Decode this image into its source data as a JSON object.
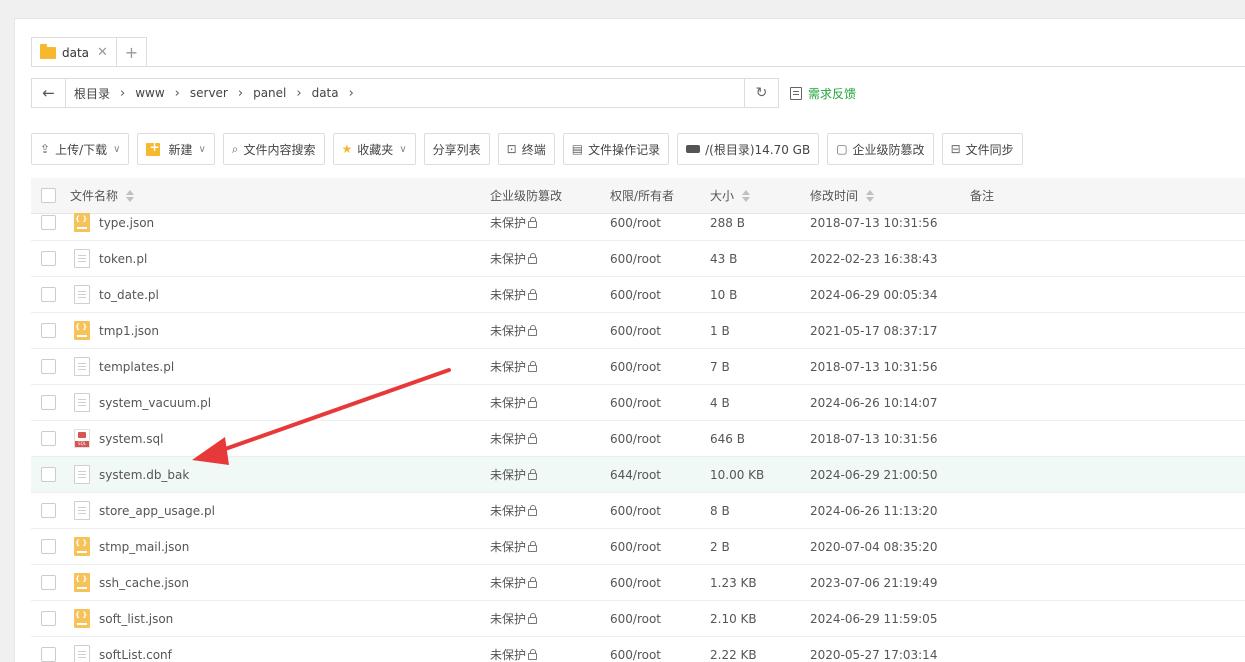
{
  "tabs": [
    {
      "label": "data"
    }
  ],
  "tab_add": "+",
  "breadcrumb": [
    "根目录",
    "www",
    "server",
    "panel",
    "data"
  ],
  "feedback": "需求反馈",
  "toolbar": {
    "upload": "上传/下载",
    "new": "新建",
    "search": "文件内容搜索",
    "favorites": "收藏夹",
    "share": "分享列表",
    "terminal": "终端",
    "oplog": "文件操作记录",
    "disk": "/(根目录)14.70 GB",
    "tamper": "企业级防篡改",
    "sync": "文件同步"
  },
  "columns": {
    "name": "文件名称",
    "tamper": "企业级防篡改",
    "perm": "权限/所有者",
    "size": "大小",
    "mtime": "修改时间",
    "note": "备注"
  },
  "rows": [
    {
      "name": "type.json",
      "icon": "json",
      "protect": "未保护",
      "perm": "600/root",
      "size": "288 B",
      "mtime": "2018-07-13 10:31:56"
    },
    {
      "name": "token.pl",
      "icon": "txt",
      "protect": "未保护",
      "perm": "600/root",
      "size": "43 B",
      "mtime": "2022-02-23 16:38:43"
    },
    {
      "name": "to_date.pl",
      "icon": "txt",
      "protect": "未保护",
      "perm": "600/root",
      "size": "10 B",
      "mtime": "2024-06-29 00:05:34"
    },
    {
      "name": "tmp1.json",
      "icon": "json",
      "protect": "未保护",
      "perm": "600/root",
      "size": "1 B",
      "mtime": "2021-05-17 08:37:17"
    },
    {
      "name": "templates.pl",
      "icon": "txt",
      "protect": "未保护",
      "perm": "600/root",
      "size": "7 B",
      "mtime": "2018-07-13 10:31:56"
    },
    {
      "name": "system_vacuum.pl",
      "icon": "txt",
      "protect": "未保护",
      "perm": "600/root",
      "size": "4 B",
      "mtime": "2024-06-26 10:14:07"
    },
    {
      "name": "system.sql",
      "icon": "sql",
      "protect": "未保护",
      "perm": "600/root",
      "size": "646 B",
      "mtime": "2018-07-13 10:31:56"
    },
    {
      "name": "system.db_bak",
      "icon": "txt",
      "protect": "未保护",
      "perm": "644/root",
      "size": "10.00 KB",
      "mtime": "2024-06-29 21:00:50",
      "highlighted": true
    },
    {
      "name": "store_app_usage.pl",
      "icon": "txt",
      "protect": "未保护",
      "perm": "600/root",
      "size": "8 B",
      "mtime": "2024-06-26 11:13:20"
    },
    {
      "name": "stmp_mail.json",
      "icon": "json",
      "protect": "未保护",
      "perm": "600/root",
      "size": "2 B",
      "mtime": "2020-07-04 08:35:20"
    },
    {
      "name": "ssh_cache.json",
      "icon": "json",
      "protect": "未保护",
      "perm": "600/root",
      "size": "1.23 KB",
      "mtime": "2023-07-06 21:19:49"
    },
    {
      "name": "soft_list.json",
      "icon": "json",
      "protect": "未保护",
      "perm": "600/root",
      "size": "2.10 KB",
      "mtime": "2024-06-29 11:59:05"
    },
    {
      "name": "softList.conf",
      "icon": "txt",
      "protect": "未保护",
      "perm": "600/root",
      "size": "2.22 KB",
      "mtime": "2020-05-27 17:03:14"
    }
  ],
  "colors": {
    "accent": "#20a53a",
    "highlight_row": "#f1f9f6",
    "annotation_arrow": "#e8393a"
  }
}
